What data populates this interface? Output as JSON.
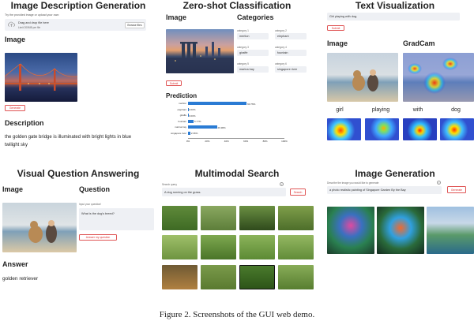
{
  "caption": "Figure 2. Screenshots of the GUI web demo.",
  "image_description": {
    "title": "Image Description Generation",
    "upload_hint": "Try the provided image or upload your own:",
    "drop_label": "Drag and drop file here",
    "limit_label": "Limit 200MB per file",
    "browse_label": "Browse files",
    "image_heading": "Image",
    "generate_label": "Generate",
    "description_heading": "Description",
    "description_text_1": "the golden gate bridge is illuminated with bright lights in blue",
    "description_text_2": "twilight sky"
  },
  "zero_shot": {
    "title": "Zero-shot Classification",
    "image_heading": "Image",
    "categories_heading": "Categories",
    "categories": [
      {
        "label": "category 1",
        "value": "merlion"
      },
      {
        "label": "category 2",
        "value": "elephant"
      },
      {
        "label": "category 3",
        "value": "giraffe"
      },
      {
        "label": "category 4",
        "value": "fountain"
      },
      {
        "label": "category 5",
        "value": "marina bay"
      },
      {
        "label": "category 6",
        "value": "singapore river"
      }
    ],
    "submit_label": "Submit",
    "prediction_heading": "Prediction"
  },
  "chart_data": {
    "type": "bar",
    "orientation": "horizontal",
    "categories": [
      "merlion",
      "elephant",
      "giraffe",
      "fountain",
      "marina bay",
      "singapore river"
    ],
    "values": [
      60.76,
      0.0,
      0.0,
      5.77,
      29.96,
      2.36
    ],
    "value_labels": [
      "60.76%",
      "0.00%",
      "0.00%",
      "5.77%",
      "29.96%",
      "2.36%"
    ],
    "xlim": [
      0,
      100
    ],
    "ticks": [
      "0%",
      "20%",
      "40%",
      "60%",
      "80%",
      "100%"
    ],
    "color": "#2a7bd4"
  },
  "text_vis": {
    "title": "Text Visualization",
    "query": "Girl playing with dog.",
    "submit_label": "Submit",
    "image_heading": "Image",
    "gradcam_heading": "GradCam",
    "words": [
      "girl",
      "playing",
      "with",
      "dog"
    ]
  },
  "vqa": {
    "title": "Visual Question Answering",
    "image_heading": "Image",
    "question_heading": "Question",
    "input_label": "Input your question!",
    "question_text": "What is the dog's breed?",
    "answer_button": "Answer my question",
    "answer_heading": "Answer",
    "answer_text": "golden retriever"
  },
  "search": {
    "title": "Multimodal Search",
    "query_label": "Search query",
    "query_text": "A dog running on the grass.",
    "search_label": "Search"
  },
  "generation": {
    "title": "Image Generation",
    "prompt_label": "Describe the image you would like to generate",
    "prompt_text": "a photo realistic painting of Singapore Garden By the Bay",
    "generate_label": "Generate"
  }
}
